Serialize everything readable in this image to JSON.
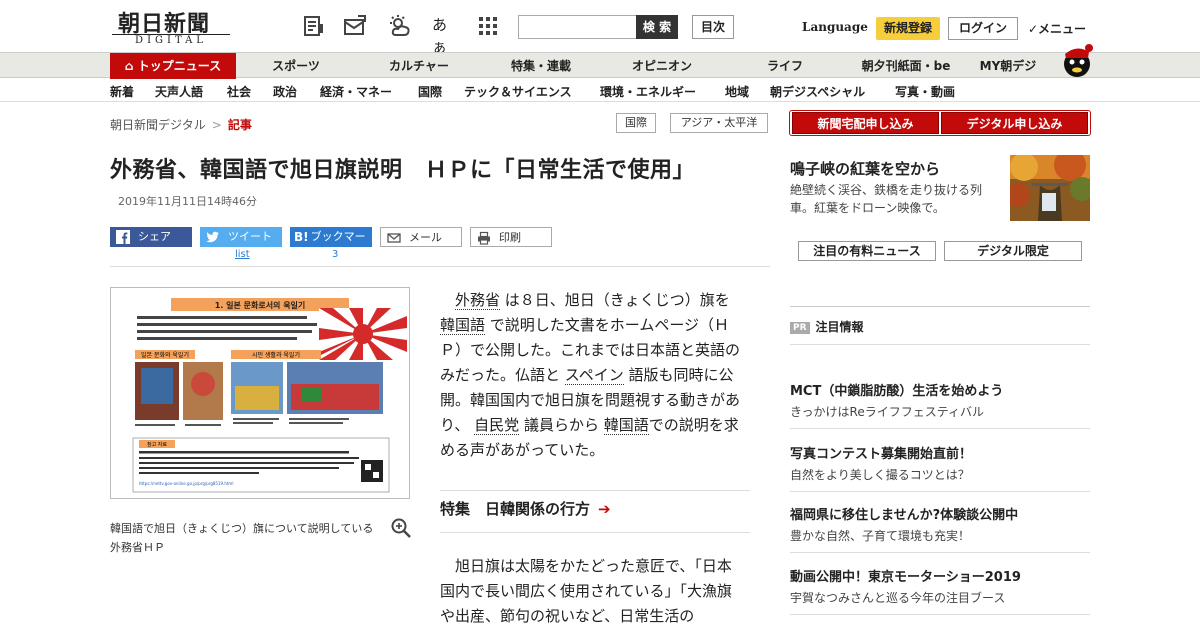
{
  "header": {
    "logo_jp": "朝日新聞",
    "logo_en": "DIGITAL",
    "icons": [
      "paper-icon",
      "mail-icon",
      "weather-icon",
      "font-size-icon",
      "grid-menu-icon"
    ],
    "font_icon_text": "あぁ",
    "search_placeholder": "",
    "search_button": "検 索",
    "toc_button": "目次",
    "language": "Language",
    "register": "新規登録",
    "login": "ログイン",
    "menu": "✓メニュー"
  },
  "nav_primary": [
    {
      "label": "トップニュース",
      "active": true
    },
    {
      "label": "スポーツ"
    },
    {
      "label": "カルチャー"
    },
    {
      "label": "特集・連載"
    },
    {
      "label": "オピニオン"
    },
    {
      "label": "ライフ"
    },
    {
      "label": "朝夕刊紙面・be"
    },
    {
      "label": "MY朝デジ"
    }
  ],
  "nav_secondary": [
    "新着",
    "天声人語",
    "社会",
    "政治",
    "経済・マネー",
    "国際",
    "テック＆サイエンス",
    "環境・エネルギー",
    "地域",
    "朝デジスペシャル",
    "写真・動画"
  ],
  "breadcrumb": {
    "root": "朝日新聞デジタル",
    "sep": ">",
    "current": "記事"
  },
  "tags": [
    "国際",
    "アジア・太平洋"
  ],
  "subscribe_buttons": [
    "新聞宅配申し込み",
    "デジタル申し込み"
  ],
  "article": {
    "headline": "外務省、韓国語で旭日旗説明　ＨＰに「日常生活で使用」",
    "date": "2019年11月11日14時46分",
    "share": {
      "facebook": "シェア",
      "twitter": "ツイート",
      "hatena": "ブックマーク",
      "mail": "メール",
      "print": "印刷",
      "twitter_count": "list",
      "hatena_count": "3"
    },
    "figure_caption": "韓国語で旭日（きょくじつ）旗について説明している外務省ＨＰ",
    "figure": {
      "title": "1. 일본 문화로서의 욱일기",
      "intro": "욱일기 디자인은 일장기와 마찬가지로 태양을 상징한다. 이 디자인은 일본 국내에서 오랫동안 폭넓게 사용되어 왔다. 오늘날에도 욱일기 디자인은 풍어기나 출산, 명절 등 일상생활 속 다양한 곳에서 사용되고 있다.",
      "sub1": "일본 문화와 욱일기",
      "sub2": "시민 생활과 욱일기",
      "ref": "참고 자료",
      "url": "https://nettv.gov-online.go.jp/prg/prg8519.html"
    },
    "p1_parts": [
      {
        "t": "外務省",
        "link": true
      },
      {
        "t": " は８日、旭日（きょくじつ）旗を "
      },
      {
        "t": "韓国語",
        "link": true
      },
      {
        "t": " で説明した文書をホームページ（ＨＰ）で公開した。これまでは日本語と英語のみだった。仏語と "
      },
      {
        "t": "スペイン",
        "link": true
      },
      {
        "t": " 語版も同時に公開。韓国国内で旭日旗を問題視する動きがあり、 "
      },
      {
        "t": "自民党",
        "link": true
      },
      {
        "t": " 議員らから "
      },
      {
        "t": "韓国語",
        "link": true
      },
      {
        "t": "での説明を求める声があがっていた。"
      }
    ],
    "feature_link": "特集　日韓関係の行方",
    "feature_arrow": "➔",
    "p2": "旭日旗は太陽をかたどった意匠で、「日本国内で長い間広く使用されている」「大漁旗や出産、節句の祝いなど、日常生活の"
  },
  "sidebar": {
    "feature_title": "鳴子峡の紅葉を空から",
    "feature_desc": "絶壁続く渓谷、鉄橋を走り抜ける列車。紅葉をドローン映像で。",
    "tabs": [
      "注目の有料ニュース",
      "デジタル限定"
    ],
    "pr_badge": "PR",
    "pr_label": "注目情報",
    "promos": [
      {
        "title": "MCT（中鎖脂肪酸）生活を始めよう",
        "sub": "きっかけはReライフフェスティバル"
      },
      {
        "title": "写真コンテスト募集開始直前！",
        "sub": "自然をより美しく撮るコツとは？"
      },
      {
        "title": "福岡県に移住しませんか?体験談公開中",
        "sub": "豊かな自然、子育て環境も充実！"
      },
      {
        "title": "動画公開中！東京モーターショー2019",
        "sub": "宇賀なつみさんと巡る今年の注目ブース"
      }
    ]
  },
  "colors": {
    "accent_red": "#c20a0a",
    "register_yellow": "#f6cd3b",
    "nav_bg": "#e9e9e4"
  }
}
